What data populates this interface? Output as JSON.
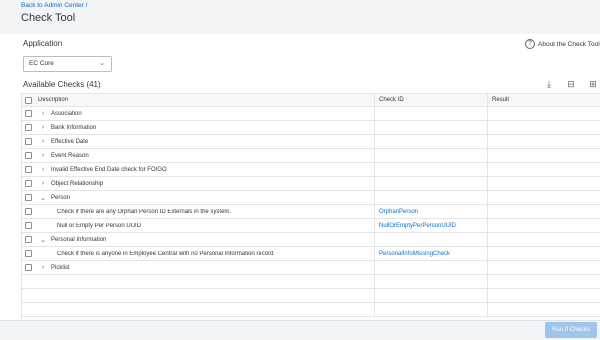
{
  "header": {
    "breadcrumb": "Back to Admin Center /",
    "title": "Check Tool"
  },
  "application": {
    "label": "Application",
    "selected": "EC Core",
    "about_link": "About the Check Tool"
  },
  "checks": {
    "title": "Available Checks (41)",
    "columns": {
      "description": "Description",
      "check_id": "Check ID",
      "result": "Result"
    },
    "rows": [
      {
        "desc": "Association",
        "type": "group",
        "expanded": false
      },
      {
        "desc": "Bank Information",
        "type": "group",
        "expanded": false
      },
      {
        "desc": "Effective Date",
        "type": "group",
        "expanded": false
      },
      {
        "desc": "Event Reason",
        "type": "group",
        "expanded": false
      },
      {
        "desc": "Invalid Effective End Date check for FO/GO",
        "type": "group",
        "expanded": false
      },
      {
        "desc": "Object Relationship",
        "type": "group",
        "expanded": false
      },
      {
        "desc": "Person",
        "type": "group",
        "expanded": true
      },
      {
        "desc": "Check if there are any Orphan Person ID Externals in the system.",
        "type": "item",
        "id": "OrphanPerson"
      },
      {
        "desc": "Null or Empty Per Person UUID",
        "type": "item",
        "id": "NullOrEmptyPerPersonUUID"
      },
      {
        "desc": "Personal Information",
        "type": "group",
        "expanded": true
      },
      {
        "desc": "Check if there is anyone in Employee Central with no Personal Information record",
        "type": "item",
        "id": "PersonalInfoMissingCheck"
      },
      {
        "desc": "Picklist",
        "type": "group",
        "expanded": false
      }
    ],
    "empty_rows": 3
  },
  "footer": {
    "run_label": "Run 0 Checks"
  },
  "icons": {
    "download": "download-icon",
    "collapse": "collapse-all-icon",
    "expand": "expand-all-icon",
    "help": "help-icon"
  },
  "colors": {
    "accent": "#0a6ed1",
    "run_button": "#9fc5ea"
  }
}
